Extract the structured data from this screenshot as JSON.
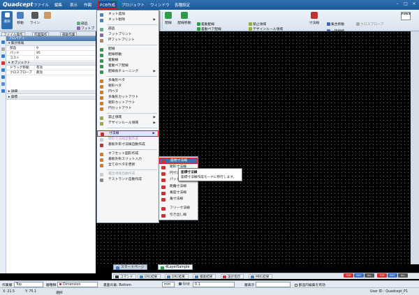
{
  "app": {
    "logo": "Quadcept"
  },
  "menubar": {
    "items": [
      "ファイル",
      "編集",
      "表示",
      "作図",
      "PCB作成",
      "プロジェクト",
      "ウィンドウ",
      "各種設定"
    ]
  },
  "ribbon": {
    "select": "選択",
    "move": "移動",
    "line": "ライン",
    "parts": "部品",
    "footprint": "フットプ",
    "ip": "IPフット",
    "wiring": "配線",
    "wiring_move": "配線移動",
    "group1": [
      "差動配線",
      "差動ペア配線",
      "配線長チューニング"
    ],
    "group2": [
      "禁止領域",
      "デザインルール領域"
    ],
    "dimension": "寸法線",
    "batch_move": "集合移動",
    "batch_edit": "一括接続",
    "cross_probe": "クロスプローブ",
    "force": "FORCE"
  },
  "panel_tabs": [
    "ファイル操作",
    "作図操作",
    "補助作業"
  ],
  "properties": {
    "header": "プロパティ",
    "sections": {
      "summary": "集計情報",
      "object": "オブジェクト",
      "detail": "詳細",
      "coord": "座標"
    },
    "rows": [
      {
        "key": "部品",
        "value": "9"
      },
      {
        "key": "パッド",
        "value": "95"
      },
      {
        "key": "コスト",
        "value": "0"
      }
    ],
    "obj_rows": [
      {
        "key": "ドラッグ移動",
        "value": "有効"
      },
      {
        "key": "クロスプローブ",
        "value": "無効"
      }
    ]
  },
  "dropdown": {
    "items": [
      {
        "label": "ネット追加",
        "arrow": false,
        "disabled": false
      },
      {
        "label": "ネット削除",
        "arrow": true,
        "disabled": false
      },
      {
        "label": "部品",
        "arrow": false,
        "disabled": false
      },
      {
        "label": "フットプリント",
        "arrow": false,
        "disabled": false
      },
      {
        "label": "IPフットプリント",
        "arrow": false,
        "disabled": false
      },
      {
        "label": "配線",
        "arrow": false,
        "disabled": false
      },
      {
        "label": "配線移動",
        "arrow": false,
        "disabled": false
      },
      {
        "label": "差動線",
        "arrow": false,
        "disabled": false
      },
      {
        "label": "差動ペア配線",
        "arrow": false,
        "disabled": false
      },
      {
        "label": "配線長チューニング",
        "arrow": true,
        "disabled": false
      },
      {
        "label": "多角形ベタ",
        "arrow": false,
        "disabled": false
      },
      {
        "label": "矩形ベタ",
        "arrow": false,
        "disabled": false
      },
      {
        "label": "円ベタ",
        "arrow": false,
        "disabled": false
      },
      {
        "label": "多角形カットアウト",
        "arrow": false,
        "disabled": false
      },
      {
        "label": "矩形カットアウト",
        "arrow": false,
        "disabled": false
      },
      {
        "label": "円カットアウト",
        "arrow": false,
        "disabled": false
      },
      {
        "label": "禁止領域",
        "arrow": true,
        "disabled": false
      },
      {
        "label": "デザインルール領域",
        "arrow": true,
        "disabled": false
      },
      {
        "label": "寸法線",
        "arrow": true,
        "disabled": false
      },
      {
        "label": "原形寸法線自動作成",
        "arrow": false,
        "disabled": true
      },
      {
        "label": "基板外形寸法線自動作成",
        "arrow": false,
        "disabled": false
      },
      {
        "label": "オフセット図形作成",
        "arrow": false,
        "disabled": false
      },
      {
        "label": "基板外形スリット入力",
        "arrow": false,
        "disabled": false
      },
      {
        "label": "全てのベタを更新",
        "arrow": false,
        "disabled": false
      },
      {
        "label": "露出領域自動作成",
        "arrow": false,
        "disabled": true
      },
      {
        "label": "テストランド自動作成",
        "arrow": false,
        "disabled": false
      }
    ]
  },
  "submenu": {
    "items": [
      "座標寸法線",
      "矩形寸法線",
      "円寸法線",
      "パッド寸法線",
      "距離寸法線",
      "角度寸法線",
      "角寸法線",
      "フリー寸法線",
      "引き出し線"
    ]
  },
  "tooltip": {
    "title": "座標寸法線",
    "desc": "座標寸法線作成モードに移行します。"
  },
  "doc_tabs": [
    "スタートページ",
    "4LayerSample"
  ],
  "output_tabs": [
    "コマンド",
    "ERC結果",
    "DRC結果",
    "検索結果",
    "設計指示",
    "MRC結果"
  ],
  "layer_buttons": [
    "TOP",
    "BOT",
    "ALL",
    "TOP",
    "BOT",
    "ALL"
  ],
  "layerbar": {
    "work_layer_label": "作業層",
    "work_layer": "Top",
    "layer_type_label": "層種類",
    "layer_type": "Dimension",
    "view_label": "裏面の着: Bottom",
    "unit": "mm",
    "grid_label": "Grid",
    "grid_value": "0.1",
    "display_label": "層表示",
    "edit_part_label": "部品内編集を有効"
  },
  "statusbar": {
    "x": "X: 21.5",
    "y": "Y: 75.1",
    "mode": "選択",
    "user": "User ID : Quadcept_P1"
  },
  "colors": {
    "accent": "#2f6fb0",
    "highlight": "#d71a1a"
  }
}
